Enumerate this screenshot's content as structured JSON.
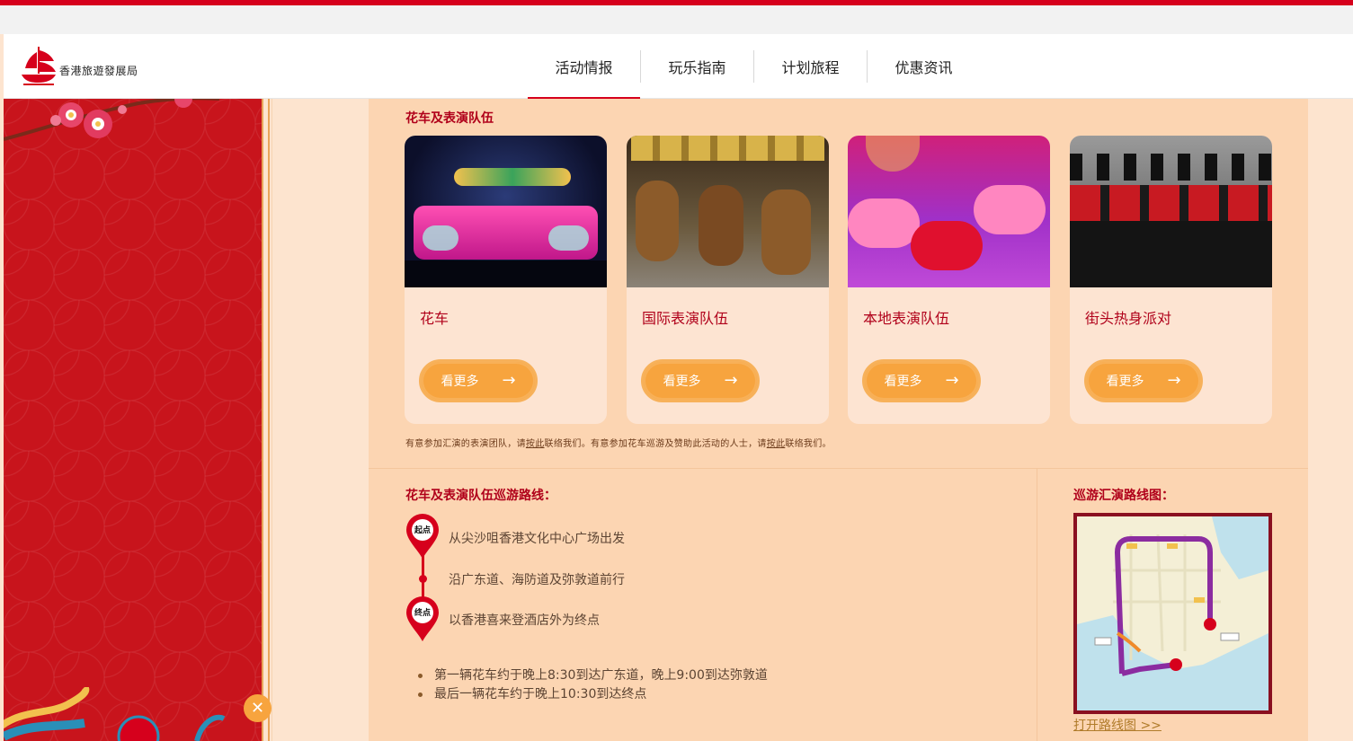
{
  "brand": {
    "logo_text": "香港旅遊發展局",
    "accent": "#d6001c"
  },
  "nav": {
    "items": [
      {
        "label": "活动情报",
        "active": true
      },
      {
        "label": "玩乐指南",
        "active": false
      },
      {
        "label": "计划旅程",
        "active": false
      },
      {
        "label": "优惠资讯",
        "active": false
      }
    ]
  },
  "floats": {
    "section_title": "花车及表演队伍",
    "cards": [
      {
        "title": "花车",
        "button": "看更多",
        "image": "illuminated-dragon-float-photo"
      },
      {
        "title": "国际表演队伍",
        "button": "看更多",
        "image": "costumed-dancers-photo"
      },
      {
        "title": "本地表演队伍",
        "button": "看更多",
        "image": "ballet-dancers-photo"
      },
      {
        "title": "街头热身派对",
        "button": "看更多",
        "image": "marching-band-photo"
      }
    ],
    "note_parts": {
      "p1": "有意参加汇演的表演团队，请",
      "link1": "按此",
      "p2": "联络我们。有意参加花车巡游及赞助此活动的人士，请",
      "link2": "按此",
      "p3": "联络我们。"
    }
  },
  "route": {
    "title": "花车及表演队伍巡游路线：",
    "start_label": "起点",
    "end_label": "终点",
    "start_text": "从尖沙咀香港文化中心广场出发",
    "middle_text": "沿广东道、海防道及弥敦道前行",
    "end_text": "以香港喜来登酒店外为终点",
    "bullets": [
      "第一辆花车约于晚上8:30到达广东道，晚上9:00到达弥敦道",
      "最后一辆花车约于晚上10:30到达终点"
    ]
  },
  "map": {
    "title": "巡游汇演路线图：",
    "link": "打开路线图 >>"
  }
}
